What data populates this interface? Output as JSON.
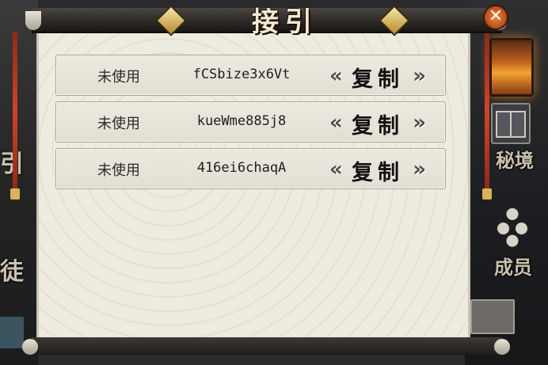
{
  "dialog": {
    "title": "接引",
    "close_symbol": "✕"
  },
  "side": {
    "left_glyph_1": "引",
    "left_glyph_2": "徒",
    "right_label_1": "秘境",
    "right_label_2": "成员"
  },
  "codes": [
    {
      "status": "未使用",
      "code": "fCSbize3x6Vt",
      "copy_label": "复制"
    },
    {
      "status": "未使用",
      "code": "kueWme885j8",
      "copy_label": "复制"
    },
    {
      "status": "未使用",
      "code": "416ei6chaqA",
      "copy_label": "复制"
    }
  ],
  "colors": {
    "paper": "#eeebe1",
    "frame_dark": "#2a2725",
    "accent_gold": "#b58a2c",
    "close_orange": "#d0642a"
  },
  "icons": {
    "close": "close-icon",
    "arrow_left": "double-chevron-left-icon",
    "arrow_right": "double-chevron-right-icon"
  }
}
